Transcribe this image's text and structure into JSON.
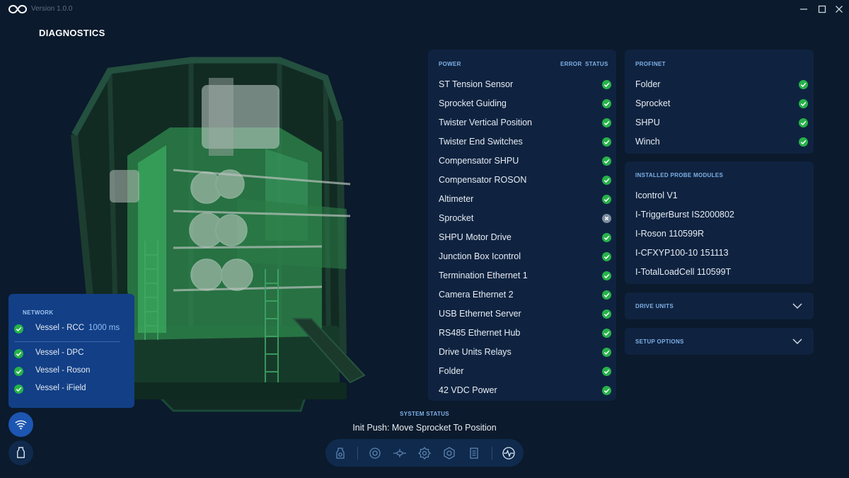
{
  "app": {
    "version": "Version 1.0.0"
  },
  "page": {
    "title": "DIAGNOSTICS"
  },
  "power": {
    "heading": "POWER",
    "col_error": "ERROR",
    "col_status": "STATUS",
    "items": [
      {
        "label": "ST Tension Sensor",
        "status": "ok"
      },
      {
        "label": "Sprocket Guiding",
        "status": "ok"
      },
      {
        "label": "Twister Vertical Position",
        "status": "ok"
      },
      {
        "label": "Twister End Switches",
        "status": "ok"
      },
      {
        "label": "Compensator SHPU",
        "status": "ok"
      },
      {
        "label": "Compensator ROSON",
        "status": "ok"
      },
      {
        "label": "Altimeter",
        "status": "ok"
      },
      {
        "label": "Sprocket",
        "status": "error"
      },
      {
        "label": "SHPU Motor Drive",
        "status": "ok"
      },
      {
        "label": "Junction Box Icontrol",
        "status": "ok"
      },
      {
        "label": "Termination Ethernet 1",
        "status": "ok"
      },
      {
        "label": "Camera Ethernet 2",
        "status": "ok"
      },
      {
        "label": "USB Ethernet Server",
        "status": "ok"
      },
      {
        "label": "RS485 Ethernet Hub",
        "status": "ok"
      },
      {
        "label": "Drive Units Relays",
        "status": "ok"
      },
      {
        "label": "Folder",
        "status": "ok"
      },
      {
        "label": "42 VDC Power",
        "status": "ok"
      }
    ]
  },
  "profinet": {
    "heading": "PROFINET",
    "items": [
      {
        "label": "Folder",
        "status": "ok"
      },
      {
        "label": "Sprocket",
        "status": "ok"
      },
      {
        "label": "SHPU",
        "status": "ok"
      },
      {
        "label": "Winch",
        "status": "ok"
      }
    ]
  },
  "probe_modules": {
    "heading": "INSTALLED PROBE MODULES",
    "items": [
      "Icontrol V1",
      "I-TriggerBurst IS2000802",
      "I-Roson 110599R",
      "I-CFXYP100-10 151113",
      "I-TotalLoadCell 110599T"
    ]
  },
  "drive_units": {
    "heading": "DRIVE UNITS"
  },
  "setup_options": {
    "heading": "SETUP OPTIONS"
  },
  "network": {
    "heading": "NETWORK",
    "items": [
      {
        "label": "Vessel - RCC",
        "latency": "1000 ms",
        "status": "ok"
      },
      {
        "label": "Vessel - DPC",
        "status": "ok"
      },
      {
        "label": "Vessel - Roson",
        "status": "ok"
      },
      {
        "label": "Vessel - iField",
        "status": "ok"
      }
    ]
  },
  "system_status": {
    "heading": "SYSTEM STATUS",
    "text": "Init Push: Move Sprocket To Position"
  },
  "colors": {
    "background": "#0b1a2c",
    "panel": "#0f2340",
    "accent": "#7fb0e6",
    "ok": "#27b24a",
    "network_panel": "#123f86"
  },
  "icons": {
    "window": [
      "minimize-icon",
      "maximize-icon",
      "close-icon"
    ],
    "side": [
      "wifi-icon",
      "bell-icon"
    ],
    "toolbar": [
      "probe-icon",
      "sprocket-icon",
      "drone-icon",
      "gear-icon",
      "compensator-icon",
      "scroll-icon",
      "pulse-icon"
    ]
  }
}
